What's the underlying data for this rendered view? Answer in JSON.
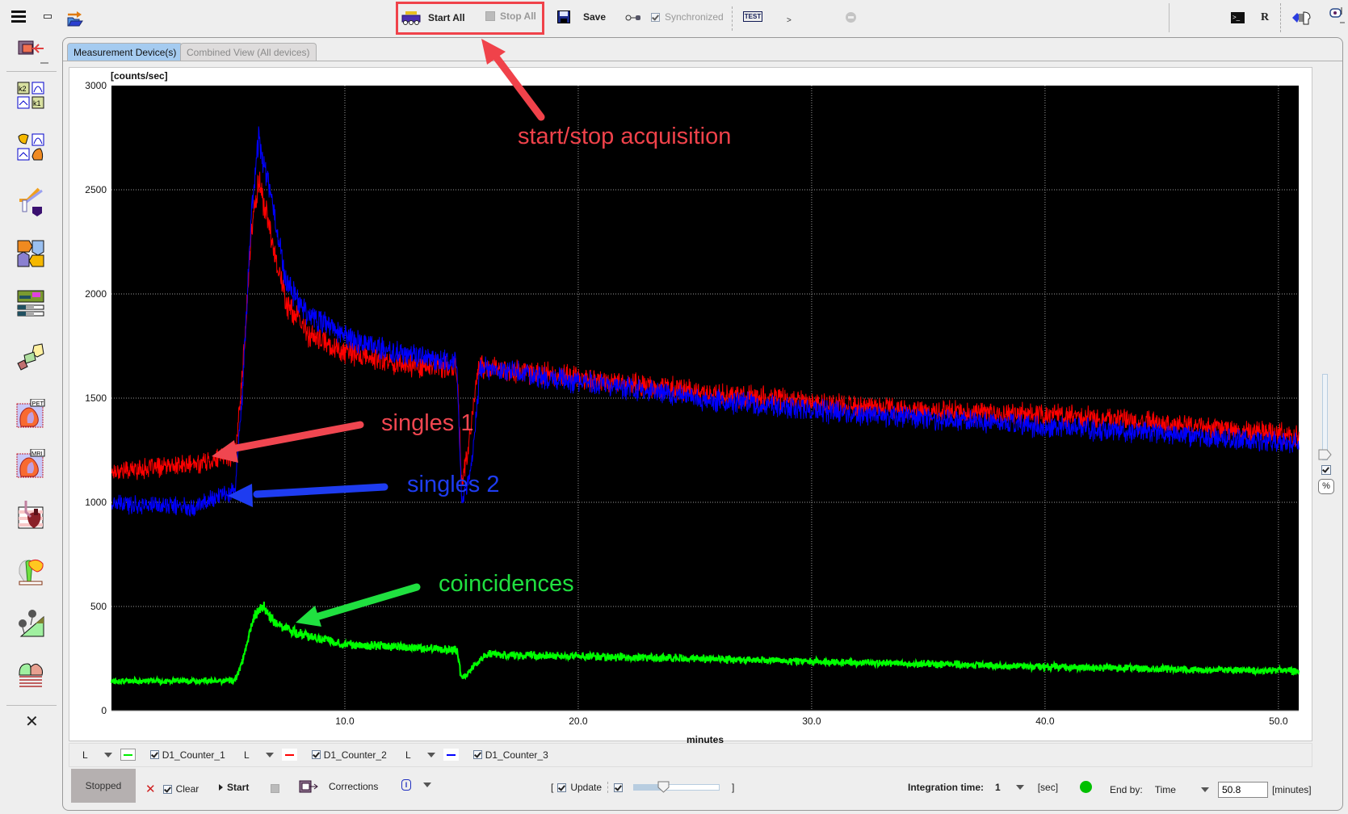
{
  "toolbar": {
    "start_all": "Start All",
    "stop_all": "Stop All",
    "save": "Save",
    "synchronized": "Synchronized",
    "test_label": "TEST",
    "more": ">",
    "r_label": "R"
  },
  "tabs": [
    {
      "label": "Measurement Device(s)",
      "active": true
    },
    {
      "label": "Combined View (All devices)",
      "active": false
    }
  ],
  "sidebar": {
    "icons": [
      "kinetic-model-icon",
      "compartment-k2k1-icon",
      "compartment-model-icon",
      "pipeline-icon",
      "puzzle-icon",
      "image-bars-icon",
      "3d-shapes-icon",
      "pet-cardiac-icon",
      "mri-cardiac-icon",
      "cardiac-catheter-icon",
      "brain-head-icon",
      "tree-pyramid-icon",
      "body-coil-icon"
    ]
  },
  "annotations": {
    "start_stop": "start/stop acquisition",
    "singles1": "singles 1",
    "singles2": "singles 2",
    "coincidences": "coincidences",
    "highlight_color": "#f0424a"
  },
  "legend": [
    {
      "mode": "L",
      "name": "D1_Counter_1",
      "color": "#00ee00",
      "checked": true
    },
    {
      "mode": "L",
      "name": "D1_Counter_2",
      "color": "#ff0000",
      "checked": true
    },
    {
      "mode": "L",
      "name": "D1_Counter_3",
      "color": "#0000ff",
      "checked": true
    }
  ],
  "bottom": {
    "status": "Stopped",
    "clear": "Clear",
    "start": "Start",
    "corrections": "Corrections",
    "update_open": "[",
    "update": "Update",
    "update_close": "]",
    "update_slider_fraction": 0.35,
    "integration_label": "Integration time:",
    "integration_value": "1",
    "integration_unit": "[sec]",
    "status_color": "#00c000",
    "end_by_label": "End by:",
    "end_by_value": "Time",
    "end_value": "50.8",
    "end_unit": "[minutes]"
  },
  "right_panel": {
    "percent_label": "%",
    "slider_fraction": 0.0
  },
  "chart_data": {
    "type": "line",
    "title": "",
    "ylabel": "[counts/sec]",
    "xlabel": "minutes",
    "xlim": [
      0,
      50.87
    ],
    "ylim": [
      0,
      3000
    ],
    "xticks": [
      10.0,
      20.0,
      30.0,
      40.0,
      50.0
    ],
    "xtick_labels": [
      "10.0",
      "20.0",
      "30.0",
      "40.0",
      "50.0"
    ],
    "yticks": [
      0,
      500,
      1000,
      1500,
      2000,
      2500,
      3000
    ],
    "ytick_labels": [
      "0",
      "500",
      "1000",
      "1500",
      "2000",
      "2500",
      "3000"
    ],
    "grid": true,
    "background": "#000000",
    "series": [
      {
        "name": "D1_Counter_2",
        "label": "singles 1",
        "color": "#ff0000",
        "noise": 45,
        "points": [
          [
            0,
            1150
          ],
          [
            3.5,
            1180
          ],
          [
            5.3,
            1230
          ],
          [
            5.6,
            1600
          ],
          [
            6.0,
            2300
          ],
          [
            6.3,
            2550
          ],
          [
            6.8,
            2300
          ],
          [
            7.5,
            1950
          ],
          [
            8.5,
            1800
          ],
          [
            10,
            1720
          ],
          [
            12,
            1670
          ],
          [
            14.8,
            1640
          ],
          [
            15.0,
            1100
          ],
          [
            15.3,
            1250
          ],
          [
            15.7,
            1650
          ],
          [
            20,
            1600
          ],
          [
            25,
            1530
          ],
          [
            30,
            1480
          ],
          [
            35,
            1440
          ],
          [
            40,
            1420
          ],
          [
            45,
            1380
          ],
          [
            50.87,
            1320
          ]
        ]
      },
      {
        "name": "D1_Counter_3",
        "label": "singles 2",
        "color": "#0000ff",
        "noise": 45,
        "points": [
          [
            0,
            990
          ],
          [
            3.5,
            980
          ],
          [
            5.3,
            1060
          ],
          [
            5.6,
            1500
          ],
          [
            6.0,
            2400
          ],
          [
            6.3,
            2750
          ],
          [
            6.8,
            2500
          ],
          [
            7.5,
            2050
          ],
          [
            8.5,
            1900
          ],
          [
            10,
            1800
          ],
          [
            12,
            1720
          ],
          [
            14.8,
            1670
          ],
          [
            15.0,
            1000
          ],
          [
            15.4,
            1150
          ],
          [
            15.8,
            1640
          ],
          [
            20,
            1580
          ],
          [
            25,
            1500
          ],
          [
            30,
            1440
          ],
          [
            35,
            1400
          ],
          [
            40,
            1360
          ],
          [
            45,
            1330
          ],
          [
            50.87,
            1280
          ]
        ]
      },
      {
        "name": "D1_Counter_1",
        "label": "coincidences",
        "color": "#00ff00",
        "noise": 28,
        "points": [
          [
            0,
            140
          ],
          [
            5.3,
            145
          ],
          [
            5.6,
            230
          ],
          [
            6.1,
            450
          ],
          [
            6.5,
            500
          ],
          [
            7,
            420
          ],
          [
            8,
            370
          ],
          [
            10,
            320
          ],
          [
            14.8,
            290
          ],
          [
            15.0,
            150
          ],
          [
            15.5,
            210
          ],
          [
            16,
            270
          ],
          [
            20,
            260
          ],
          [
            25,
            250
          ],
          [
            30,
            235
          ],
          [
            35,
            225
          ],
          [
            40,
            210
          ],
          [
            45,
            200
          ],
          [
            50.87,
            190
          ]
        ]
      }
    ]
  }
}
